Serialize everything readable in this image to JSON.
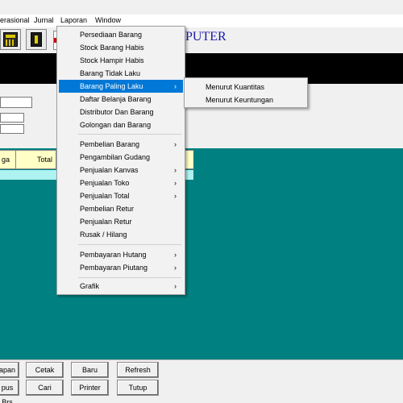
{
  "menubar": [
    "erasional",
    "Jurnal",
    "Laporan",
    "Window"
  ],
  "app_title": "PUTER",
  "grid": {
    "columns": [
      "ga",
      "Total"
    ]
  },
  "buttons_row1": [
    "apan",
    "Cetak",
    "Baru",
    "Refresh"
  ],
  "buttons_row2": [
    "pus Brs",
    "Cari",
    "Printer",
    "Tutup"
  ],
  "laporan_menu": [
    {
      "label": "Persediaan Barang"
    },
    {
      "label": "Stock Barang Habis"
    },
    {
      "label": "Stock Hampir Habis"
    },
    {
      "label": "Barang Tidak Laku"
    },
    {
      "label": "Barang Paling Laku",
      "arrow": "›"
    },
    {
      "label": "Daftar Belanja Barang"
    },
    {
      "label": "Distributor Dan Barang"
    },
    {
      "label": "Golongan dan Barang"
    },
    {
      "label": "Pembelian Barang",
      "arrow": "›"
    },
    {
      "label": "Pengambilan Gudang"
    },
    {
      "label": "Penjualan Kanvas",
      "arrow": "›"
    },
    {
      "label": "Penjualan Toko",
      "arrow": "›"
    },
    {
      "label": "Penjualan Total",
      "arrow": "›"
    },
    {
      "label": "Pembelian Retur"
    },
    {
      "label": "Penjualan Retur"
    },
    {
      "label": "Rusak / Hilang"
    },
    {
      "label": "Pembayaran Hutang",
      "arrow": "›"
    },
    {
      "label": "Pembayaran Piutang",
      "arrow": "›"
    },
    {
      "label": "Grafik",
      "arrow": "›"
    }
  ],
  "submenu": [
    "Menurut Kuantitas",
    "Menurut Keuntungan"
  ],
  "colors": {
    "teal": "#008080",
    "highlight": "#0078d7",
    "title": "#1a1aa8"
  }
}
